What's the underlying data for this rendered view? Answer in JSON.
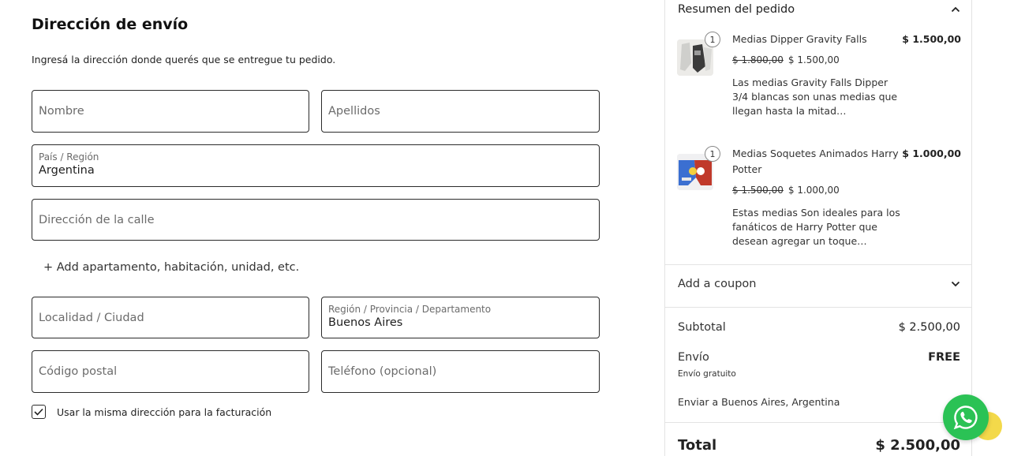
{
  "shipping_form": {
    "heading": "Dirección de envío",
    "subtitle": "Ingresá la dirección donde querés que se entregue tu pedido.",
    "first_name": {
      "placeholder": "Nombre"
    },
    "last_name": {
      "placeholder": "Apellidos"
    },
    "country": {
      "label": "País / Región",
      "value": "Argentina"
    },
    "street": {
      "placeholder": "Dirección de la calle"
    },
    "add_apartment": "+ Add apartamento, habitación, unidad, etc.",
    "city": {
      "placeholder": "Localidad / Ciudad"
    },
    "state": {
      "label": "Región / Provincia / Departamento",
      "value": "Buenos Aires"
    },
    "postcode": {
      "placeholder": "Código postal"
    },
    "phone": {
      "placeholder": "Teléfono (opcional)"
    },
    "same_billing": {
      "label": "Usar la misma dirección para la facturación",
      "checked": true
    }
  },
  "order_summary": {
    "title": "Resumen del pedido",
    "items": [
      {
        "name": "Medias Dipper Gravity Falls",
        "quantity": "1",
        "line_total": "$ 1.500,00",
        "regular_price": "$ 1.800,00",
        "sale_price": "$ 1.500,00",
        "description": "Las medias Gravity Falls Dipper 3/4 blancas son unas medias que llegan hasta la mitad…"
      },
      {
        "name": "Medias Soquetes Animados Harry Potter",
        "quantity": "1",
        "line_total": "$ 1.000,00",
        "regular_price": "$ 1.500,00",
        "sale_price": "$ 1.000,00",
        "description": "Estas medias Son ideales para los fanáticos de Harry Potter que desean agregar un toque…"
      }
    ],
    "coupon_label": "Add a coupon",
    "subtotal_label": "Subtotal",
    "subtotal_value": "$ 2.500,00",
    "shipping_label": "Envío",
    "shipping_value": "FREE",
    "shipping_method": "Envío gratuito",
    "ship_to": "Enviar a Buenos Aires, Argentina",
    "total_label": "Total",
    "total_value": "$ 2.500,00"
  },
  "widgets": {
    "whatsapp_icon": "whatsapp-icon"
  },
  "colors": {
    "whatsapp_green": "#2bc255",
    "accent_yellow": "#f3d94a",
    "border": "#2b2b2b"
  }
}
